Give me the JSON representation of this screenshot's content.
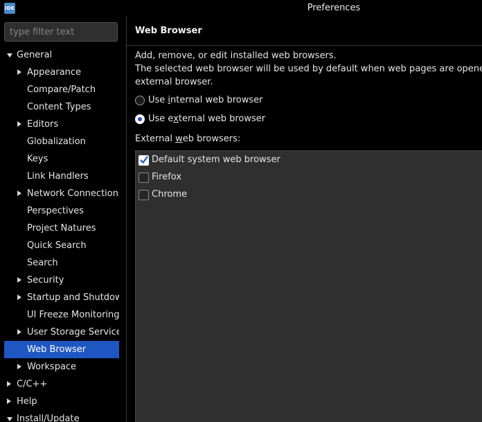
{
  "window": {
    "app_icon": "IDE",
    "title": "Preferences"
  },
  "filter": {
    "placeholder": "type filter text"
  },
  "tree": [
    {
      "label": "General",
      "level": 0,
      "arrow": "down"
    },
    {
      "label": "Appearance",
      "level": 1,
      "arrow": "right"
    },
    {
      "label": "Compare/Patch",
      "level": 1,
      "arrow": "none"
    },
    {
      "label": "Content Types",
      "level": 1,
      "arrow": "none"
    },
    {
      "label": "Editors",
      "level": 1,
      "arrow": "right"
    },
    {
      "label": "Globalization",
      "level": 1,
      "arrow": "none"
    },
    {
      "label": "Keys",
      "level": 1,
      "arrow": "none"
    },
    {
      "label": "Link Handlers",
      "level": 1,
      "arrow": "none"
    },
    {
      "label": "Network Connections",
      "level": 1,
      "arrow": "right"
    },
    {
      "label": "Perspectives",
      "level": 1,
      "arrow": "none"
    },
    {
      "label": "Project Natures",
      "level": 1,
      "arrow": "none"
    },
    {
      "label": "Quick Search",
      "level": 1,
      "arrow": "none"
    },
    {
      "label": "Search",
      "level": 1,
      "arrow": "none"
    },
    {
      "label": "Security",
      "level": 1,
      "arrow": "right"
    },
    {
      "label": "Startup and Shutdown",
      "level": 1,
      "arrow": "right"
    },
    {
      "label": "UI Freeze Monitoring",
      "level": 1,
      "arrow": "none"
    },
    {
      "label": "User Storage Service",
      "level": 1,
      "arrow": "right"
    },
    {
      "label": "Web Browser",
      "level": 1,
      "arrow": "none",
      "selected": true
    },
    {
      "label": "Workspace",
      "level": 1,
      "arrow": "right"
    },
    {
      "label": "C/C++",
      "level": 0,
      "arrow": "right"
    },
    {
      "label": "Help",
      "level": 0,
      "arrow": "right"
    },
    {
      "label": "Install/Update",
      "level": 0,
      "arrow": "down"
    }
  ],
  "page": {
    "heading": "Web Browser",
    "description_line1": "Add, remove, or edit installed web browsers.",
    "description_line2": "The selected web browser will be used by default when web pages are opened, alt",
    "description_line3": "external browser.",
    "radio_internal": {
      "pre": "Use ",
      "mnemonic": "i",
      "post": "nternal web browser",
      "checked": false
    },
    "radio_external": {
      "pre": "Use e",
      "mnemonic": "x",
      "post": "ternal web browser",
      "checked": true
    },
    "browsers_label": {
      "pre": "External ",
      "mnemonic": "w",
      "post": "eb browsers:"
    },
    "browsers": [
      {
        "label": "Default system web browser",
        "checked": true
      },
      {
        "label": "Firefox",
        "checked": false
      },
      {
        "label": "Chrome",
        "checked": false
      }
    ]
  },
  "colors": {
    "accent": "#1e57c2",
    "background": "#000000",
    "list_background": "#2f2f2f"
  }
}
